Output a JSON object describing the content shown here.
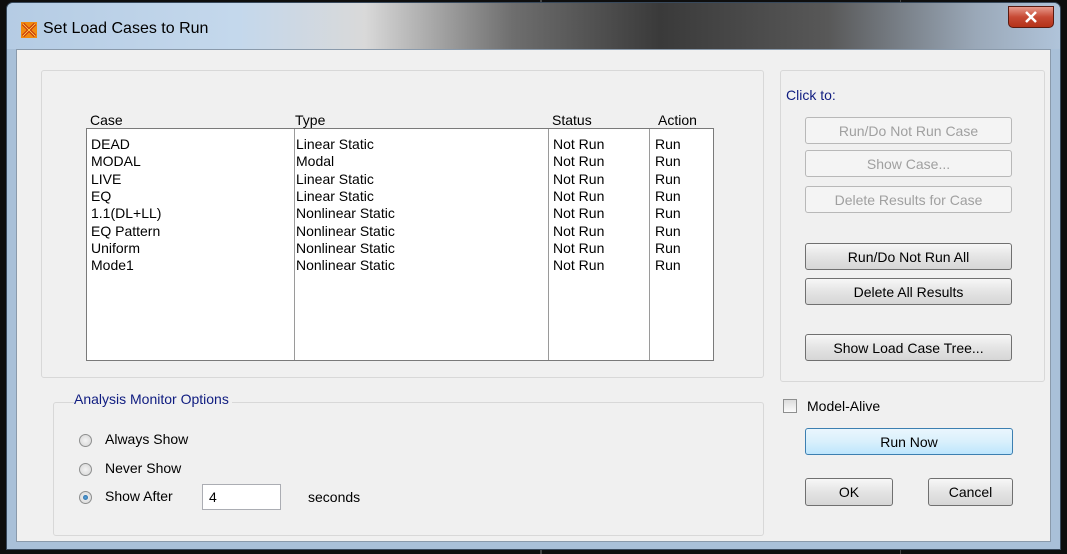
{
  "window": {
    "title": "Set Load Cases to Run"
  },
  "table": {
    "headers": {
      "case": "Case",
      "type": "Type",
      "status": "Status",
      "action": "Action"
    },
    "rows": [
      {
        "case": "DEAD",
        "type": "Linear Static",
        "status": "Not Run",
        "action": "Run"
      },
      {
        "case": "MODAL",
        "type": "Modal",
        "status": "Not Run",
        "action": "Run"
      },
      {
        "case": "LIVE",
        "type": "Linear Static",
        "status": "Not Run",
        "action": "Run"
      },
      {
        "case": "EQ",
        "type": "Linear Static",
        "status": "Not Run",
        "action": "Run"
      },
      {
        "case": "1.1(DL+LL)",
        "type": "Nonlinear Static",
        "status": "Not Run",
        "action": "Run"
      },
      {
        "case": "EQ Pattern",
        "type": "Nonlinear Static",
        "status": "Not Run",
        "action": "Run"
      },
      {
        "case": "Uniform",
        "type": "Nonlinear Static",
        "status": "Not Run",
        "action": "Run"
      },
      {
        "case": "Mode1",
        "type": "Nonlinear Static",
        "status": "Not Run",
        "action": "Run"
      }
    ]
  },
  "click_to": {
    "label": "Click to:",
    "run_do_not_run_case": "Run/Do Not Run Case",
    "show_case": "Show Case...",
    "delete_results_for_case": "Delete Results for Case",
    "run_do_not_run_all": "Run/Do Not Run All",
    "delete_all_results": "Delete All Results",
    "show_load_case_tree": "Show Load Case Tree..."
  },
  "monitor": {
    "label": "Analysis Monitor Options",
    "always_show": "Always Show",
    "never_show": "Never Show",
    "show_after": "Show After",
    "show_after_value": "4",
    "seconds": "seconds",
    "selected": "show_after"
  },
  "model_alive": {
    "label": "Model-Alive",
    "checked": false
  },
  "buttons": {
    "run_now": "Run Now",
    "ok": "OK",
    "cancel": "Cancel"
  },
  "colors": {
    "group_label": "#0f1c80",
    "selection_focus": "#3c7fb1"
  }
}
